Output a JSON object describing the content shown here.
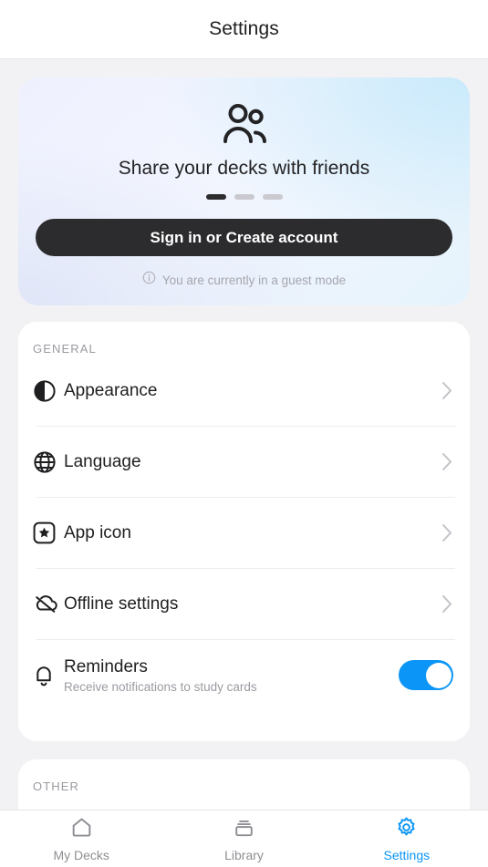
{
  "header": {
    "title": "Settings"
  },
  "promo": {
    "icon": "users-icon",
    "title": "Share your decks with friends",
    "dots": {
      "count": 3,
      "active_index": 0
    },
    "cta_label": "Sign in or Create account",
    "guest_icon": "info-circle-icon",
    "guest_text": "You are currently in a guest mode"
  },
  "sections": [
    {
      "label": "GENERAL",
      "items": [
        {
          "icon": "contrast-icon",
          "label": "Appearance",
          "sub": "",
          "accessory": "chevron"
        },
        {
          "icon": "globe-icon",
          "label": "Language",
          "sub": "",
          "accessory": "chevron"
        },
        {
          "icon": "app-icon-badge",
          "label": "App icon",
          "sub": "",
          "accessory": "chevron"
        },
        {
          "icon": "cloud-off-icon",
          "label": "Offline settings",
          "sub": "",
          "accessory": "chevron"
        },
        {
          "icon": "bell-icon",
          "label": "Reminders",
          "sub": "Receive notifications to study cards",
          "accessory": "toggle",
          "toggle_on": true
        }
      ]
    },
    {
      "label": "OTHER",
      "items": []
    }
  ],
  "tabbar": {
    "tabs": [
      {
        "icon": "home-icon",
        "label": "My Decks",
        "active": false
      },
      {
        "icon": "library-icon",
        "label": "Library",
        "active": false
      },
      {
        "icon": "gear-icon",
        "label": "Settings",
        "active": true
      }
    ]
  },
  "colors": {
    "accent": "#0b95f6",
    "cta_background": "#2c2c2e",
    "page_background": "#f2f2f4",
    "card_background": "#ffffff",
    "muted_text": "#9a9aa1"
  }
}
